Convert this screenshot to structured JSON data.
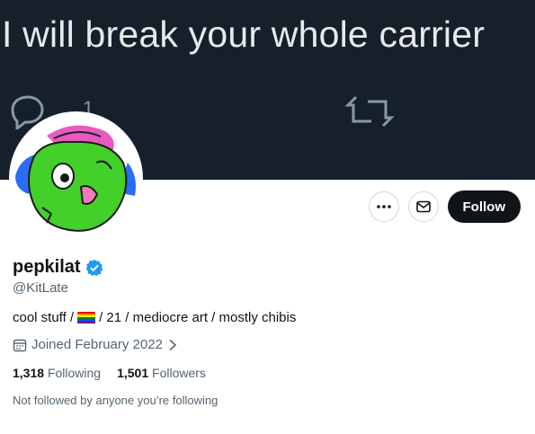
{
  "banner": {
    "text": "I will break your whole carrier",
    "reply_count": "1",
    "reply_icon": "reply-icon",
    "retweet_icon": "retweet-icon"
  },
  "profile": {
    "display_name": "pepkilat",
    "handle": "@KitLate",
    "verified_icon": "verified-badge-icon",
    "bio_before": "cool stuff /",
    "bio_after": "/ 21 / mediocre art / mostly chibis",
    "joined": "Joined February 2022",
    "following_count": "1,318",
    "following_label": "Following",
    "followers_count": "1,501",
    "followers_label": "Followers",
    "mutual_text": "Not followed by anyone you’re following"
  },
  "actions": {
    "more_icon": "more-icon",
    "message_icon": "mail-icon",
    "follow_label": "Follow"
  },
  "colors": {
    "banner_bg": "#15202b",
    "verified": "#1d9bf0",
    "follow_bg": "#0f1419"
  }
}
